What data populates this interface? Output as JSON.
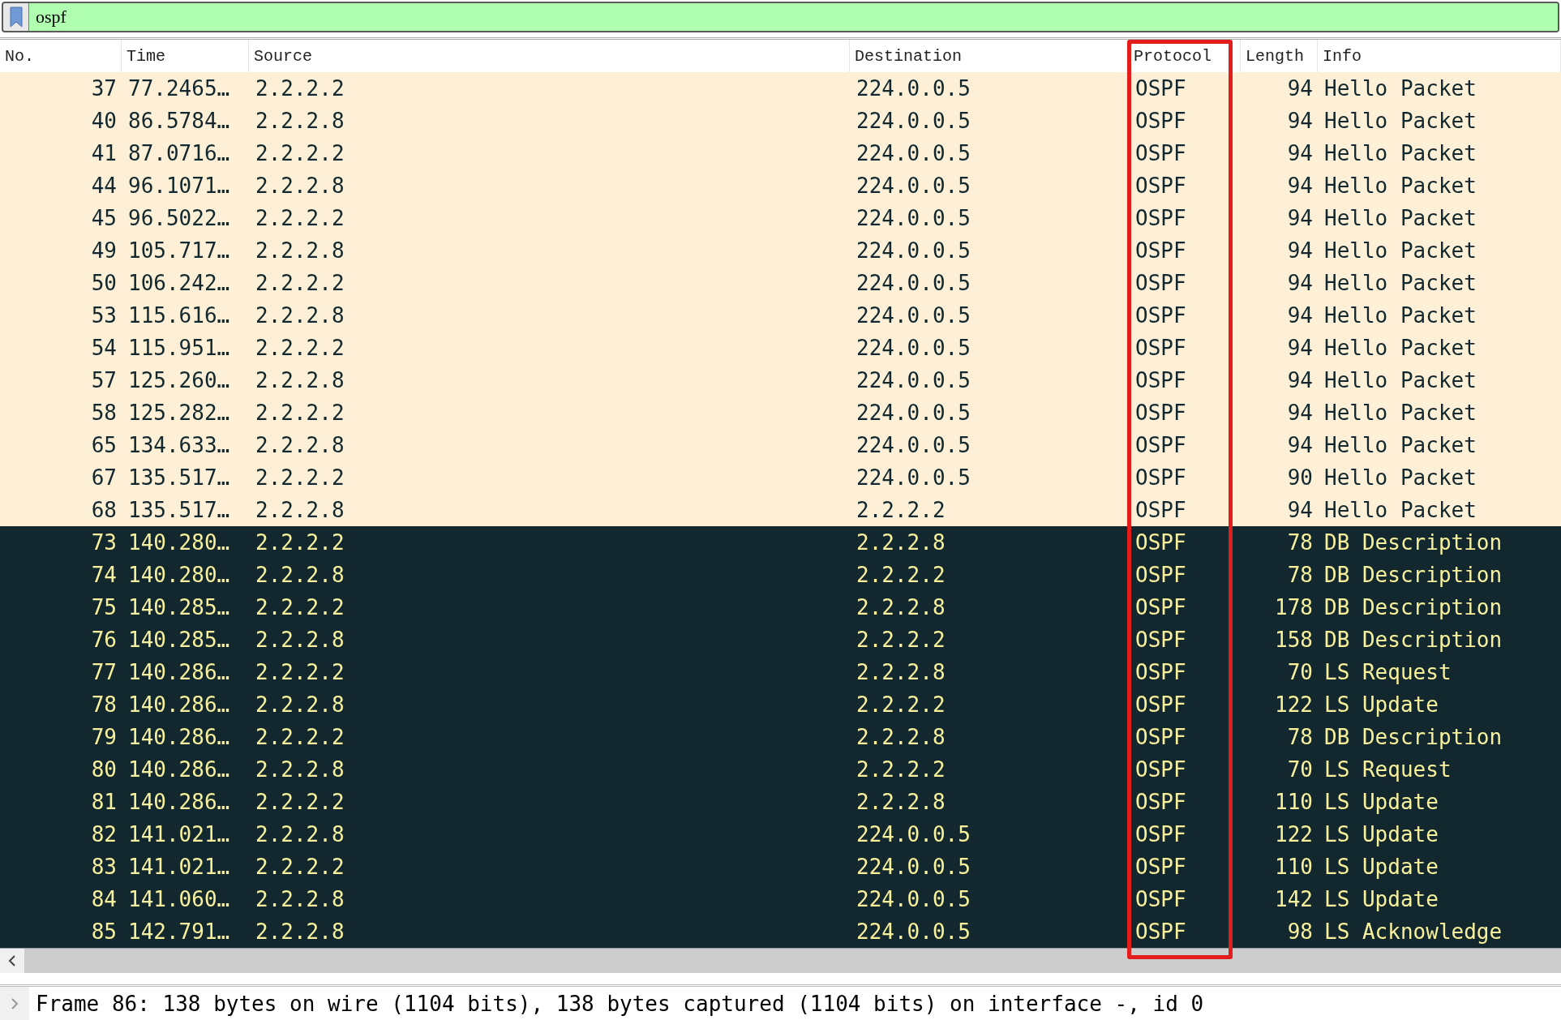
{
  "filter": {
    "value": "ospf"
  },
  "columns": [
    "No.",
    "Time",
    "Source",
    "Destination",
    "Protocol",
    "Length",
    "Info"
  ],
  "rows": [
    {
      "no": "37",
      "time": "77.2465…",
      "source": "2.2.2.2",
      "destination": "224.0.0.5",
      "protocol": "OSPF",
      "length": "94",
      "info": "Hello Packet",
      "kind": "light"
    },
    {
      "no": "40",
      "time": "86.5784…",
      "source": "2.2.2.8",
      "destination": "224.0.0.5",
      "protocol": "OSPF",
      "length": "94",
      "info": "Hello Packet",
      "kind": "light"
    },
    {
      "no": "41",
      "time": "87.0716…",
      "source": "2.2.2.2",
      "destination": "224.0.0.5",
      "protocol": "OSPF",
      "length": "94",
      "info": "Hello Packet",
      "kind": "light"
    },
    {
      "no": "44",
      "time": "96.1071…",
      "source": "2.2.2.8",
      "destination": "224.0.0.5",
      "protocol": "OSPF",
      "length": "94",
      "info": "Hello Packet",
      "kind": "light"
    },
    {
      "no": "45",
      "time": "96.5022…",
      "source": "2.2.2.2",
      "destination": "224.0.0.5",
      "protocol": "OSPF",
      "length": "94",
      "info": "Hello Packet",
      "kind": "light"
    },
    {
      "no": "49",
      "time": "105.717…",
      "source": "2.2.2.8",
      "destination": "224.0.0.5",
      "protocol": "OSPF",
      "length": "94",
      "info": "Hello Packet",
      "kind": "light"
    },
    {
      "no": "50",
      "time": "106.242…",
      "source": "2.2.2.2",
      "destination": "224.0.0.5",
      "protocol": "OSPF",
      "length": "94",
      "info": "Hello Packet",
      "kind": "light"
    },
    {
      "no": "53",
      "time": "115.616…",
      "source": "2.2.2.8",
      "destination": "224.0.0.5",
      "protocol": "OSPF",
      "length": "94",
      "info": "Hello Packet",
      "kind": "light"
    },
    {
      "no": "54",
      "time": "115.951…",
      "source": "2.2.2.2",
      "destination": "224.0.0.5",
      "protocol": "OSPF",
      "length": "94",
      "info": "Hello Packet",
      "kind": "light"
    },
    {
      "no": "57",
      "time": "125.260…",
      "source": "2.2.2.8",
      "destination": "224.0.0.5",
      "protocol": "OSPF",
      "length": "94",
      "info": "Hello Packet",
      "kind": "light"
    },
    {
      "no": "58",
      "time": "125.282…",
      "source": "2.2.2.2",
      "destination": "224.0.0.5",
      "protocol": "OSPF",
      "length": "94",
      "info": "Hello Packet",
      "kind": "light"
    },
    {
      "no": "65",
      "time": "134.633…",
      "source": "2.2.2.8",
      "destination": "224.0.0.5",
      "protocol": "OSPF",
      "length": "94",
      "info": "Hello Packet",
      "kind": "light"
    },
    {
      "no": "67",
      "time": "135.517…",
      "source": "2.2.2.2",
      "destination": "224.0.0.5",
      "protocol": "OSPF",
      "length": "90",
      "info": "Hello Packet",
      "kind": "light"
    },
    {
      "no": "68",
      "time": "135.517…",
      "source": "2.2.2.8",
      "destination": "2.2.2.2",
      "protocol": "OSPF",
      "length": "94",
      "info": "Hello Packet",
      "kind": "light"
    },
    {
      "no": "73",
      "time": "140.280…",
      "source": "2.2.2.2",
      "destination": "2.2.2.8",
      "protocol": "OSPF",
      "length": "78",
      "info": "DB Description",
      "kind": "dark"
    },
    {
      "no": "74",
      "time": "140.280…",
      "source": "2.2.2.8",
      "destination": "2.2.2.2",
      "protocol": "OSPF",
      "length": "78",
      "info": "DB Description",
      "kind": "dark"
    },
    {
      "no": "75",
      "time": "140.285…",
      "source": "2.2.2.2",
      "destination": "2.2.2.8",
      "protocol": "OSPF",
      "length": "178",
      "info": "DB Description",
      "kind": "dark"
    },
    {
      "no": "76",
      "time": "140.285…",
      "source": "2.2.2.8",
      "destination": "2.2.2.2",
      "protocol": "OSPF",
      "length": "158",
      "info": "DB Description",
      "kind": "dark"
    },
    {
      "no": "77",
      "time": "140.286…",
      "source": "2.2.2.2",
      "destination": "2.2.2.8",
      "protocol": "OSPF",
      "length": "70",
      "info": "LS Request",
      "kind": "dark"
    },
    {
      "no": "78",
      "time": "140.286…",
      "source": "2.2.2.8",
      "destination": "2.2.2.2",
      "protocol": "OSPF",
      "length": "122",
      "info": "LS Update",
      "kind": "dark"
    },
    {
      "no": "79",
      "time": "140.286…",
      "source": "2.2.2.2",
      "destination": "2.2.2.8",
      "protocol": "OSPF",
      "length": "78",
      "info": "DB Description",
      "kind": "dark"
    },
    {
      "no": "80",
      "time": "140.286…",
      "source": "2.2.2.8",
      "destination": "2.2.2.2",
      "protocol": "OSPF",
      "length": "70",
      "info": "LS Request",
      "kind": "dark"
    },
    {
      "no": "81",
      "time": "140.286…",
      "source": "2.2.2.2",
      "destination": "2.2.2.8",
      "protocol": "OSPF",
      "length": "110",
      "info": "LS Update",
      "kind": "dark"
    },
    {
      "no": "82",
      "time": "141.021…",
      "source": "2.2.2.8",
      "destination": "224.0.0.5",
      "protocol": "OSPF",
      "length": "122",
      "info": "LS Update",
      "kind": "dark"
    },
    {
      "no": "83",
      "time": "141.021…",
      "source": "2.2.2.2",
      "destination": "224.0.0.5",
      "protocol": "OSPF",
      "length": "110",
      "info": "LS Update",
      "kind": "dark"
    },
    {
      "no": "84",
      "time": "141.060…",
      "source": "2.2.2.8",
      "destination": "224.0.0.5",
      "protocol": "OSPF",
      "length": "142",
      "info": "LS Update",
      "kind": "dark"
    },
    {
      "no": "85",
      "time": "142.791…",
      "source": "2.2.2.8",
      "destination": "224.0.0.5",
      "protocol": "OSPF",
      "length": "98",
      "info": "LS Acknowledge",
      "kind": "dark"
    }
  ],
  "detail": {
    "expanded": false,
    "text": "Frame 86: 138 bytes on wire (1104 bits), 138 bytes captured (1104 bits) on interface -, id 0"
  }
}
